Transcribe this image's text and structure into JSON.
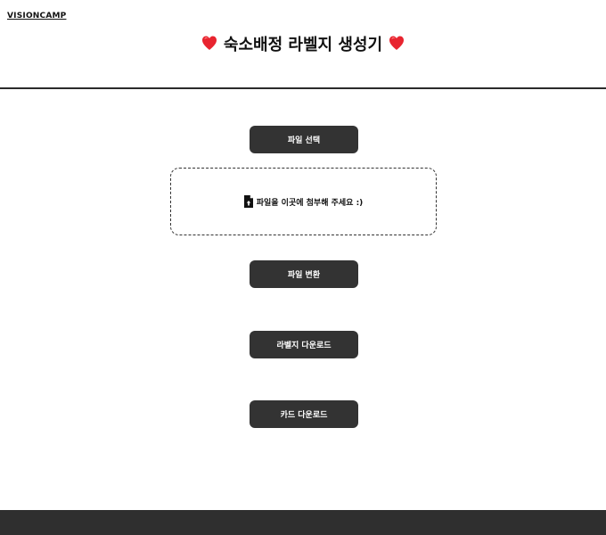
{
  "header": {
    "brand": "VISIONCAMP",
    "title": "숙소배정 라벨지 생성기"
  },
  "buttons": {
    "select_file": "파일 선택",
    "convert_file": "파일 변환",
    "download_labels": "라벨지 다운로드",
    "download_cards": "카드 다운로드"
  },
  "dropzone": {
    "text": "파일을 이곳에 첨부해 주세요 :)",
    "icon": "file-upload-icon"
  },
  "icons": {
    "title_decoration": "heart-icon"
  },
  "colors": {
    "button_bg": "#333333",
    "button_text": "#ffffff",
    "heart": "#e8242f",
    "footer_bg": "#2f2f2f",
    "divider": "#2b2b2b"
  }
}
